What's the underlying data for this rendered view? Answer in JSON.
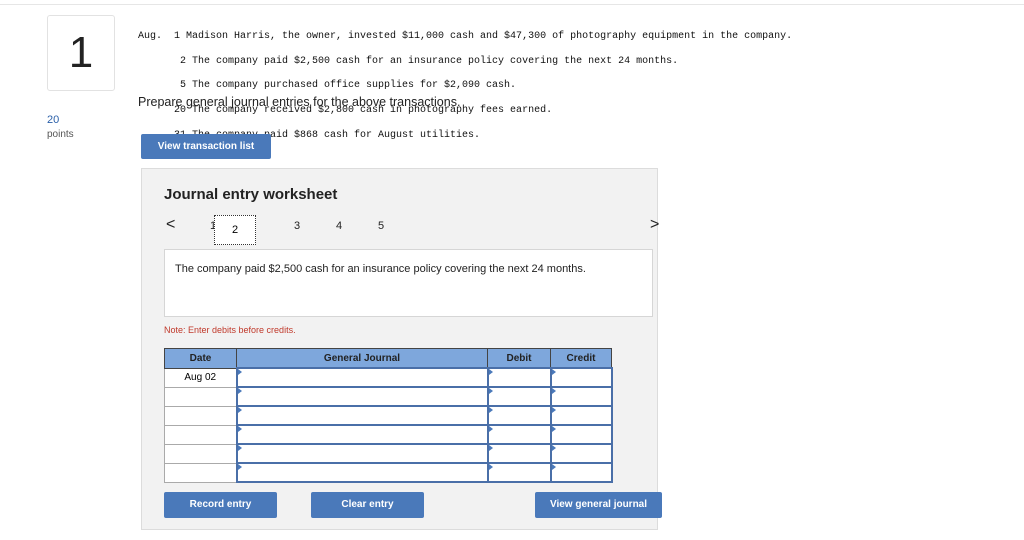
{
  "question": {
    "number": "1",
    "points": "20",
    "points_label": "points"
  },
  "transactions": [
    "Aug.  1 Madison Harris, the owner, invested $11,000 cash and $47,300 of photography equipment in the company.",
    "       2 The company paid $2,500 cash for an insurance policy covering the next 24 months.",
    "       5 The company purchased office supplies for $2,090 cash.",
    "      20 The company received $2,800 cash in photography fees earned.",
    "      31 The company paid $868 cash for August utilities."
  ],
  "prompt": "Prepare general journal entries for the above transactions.",
  "view_transaction_list": "View transaction list",
  "worksheet": {
    "title": "Journal entry worksheet",
    "prev": "<",
    "next": ">",
    "pages": [
      "1",
      "2",
      "3",
      "4",
      "5"
    ],
    "current_page": "2",
    "description": "The company paid $2,500 cash for an insurance policy covering the next 24 months.",
    "note": "Note: Enter debits before credits.",
    "columns": [
      "Date",
      "General Journal",
      "Debit",
      "Credit"
    ],
    "rows": [
      {
        "date": "Aug 02"
      },
      {
        "date": ""
      },
      {
        "date": ""
      },
      {
        "date": ""
      },
      {
        "date": ""
      },
      {
        "date": ""
      }
    ],
    "record": "Record entry",
    "clear": "Clear entry",
    "view_journal": "View general journal"
  }
}
